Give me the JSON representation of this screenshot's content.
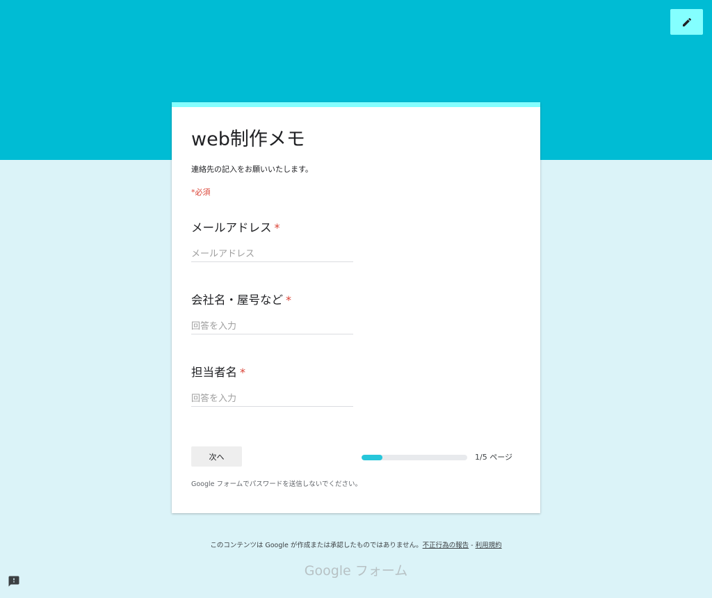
{
  "header": {
    "edit_button_icon": "pencil-icon",
    "band_color": "#00bcd4"
  },
  "form": {
    "title": "web制作メモ",
    "description": "連絡先の記入をお願いいたします。",
    "required_note": "*必須",
    "questions": [
      {
        "label": "メールアドレス",
        "required_mark": "*",
        "placeholder": "メールアドレス",
        "value": ""
      },
      {
        "label": "会社名・屋号など",
        "required_mark": "*",
        "placeholder": "回答を入力",
        "value": ""
      },
      {
        "label": "担当者名",
        "required_mark": "*",
        "placeholder": "回答を入力",
        "value": ""
      }
    ],
    "next_button": "次へ",
    "progress": {
      "fraction": 0.2,
      "text": "1/5 ページ"
    },
    "password_warning": "Google フォームでパスワードを送信しないでください。"
  },
  "footer": {
    "disclaimer": "このコンテンツは Google が作成または承認したものではありません。",
    "report_link": "不正行為の報告",
    "separator": " - ",
    "terms_link": "利用規約",
    "brand": "Google フォーム"
  },
  "colors": {
    "accent": "#84ffff",
    "required": "#db4437",
    "progress_fill": "#26c6da",
    "page_background": "#dbf3f8"
  },
  "report_icon": "feedback-icon"
}
